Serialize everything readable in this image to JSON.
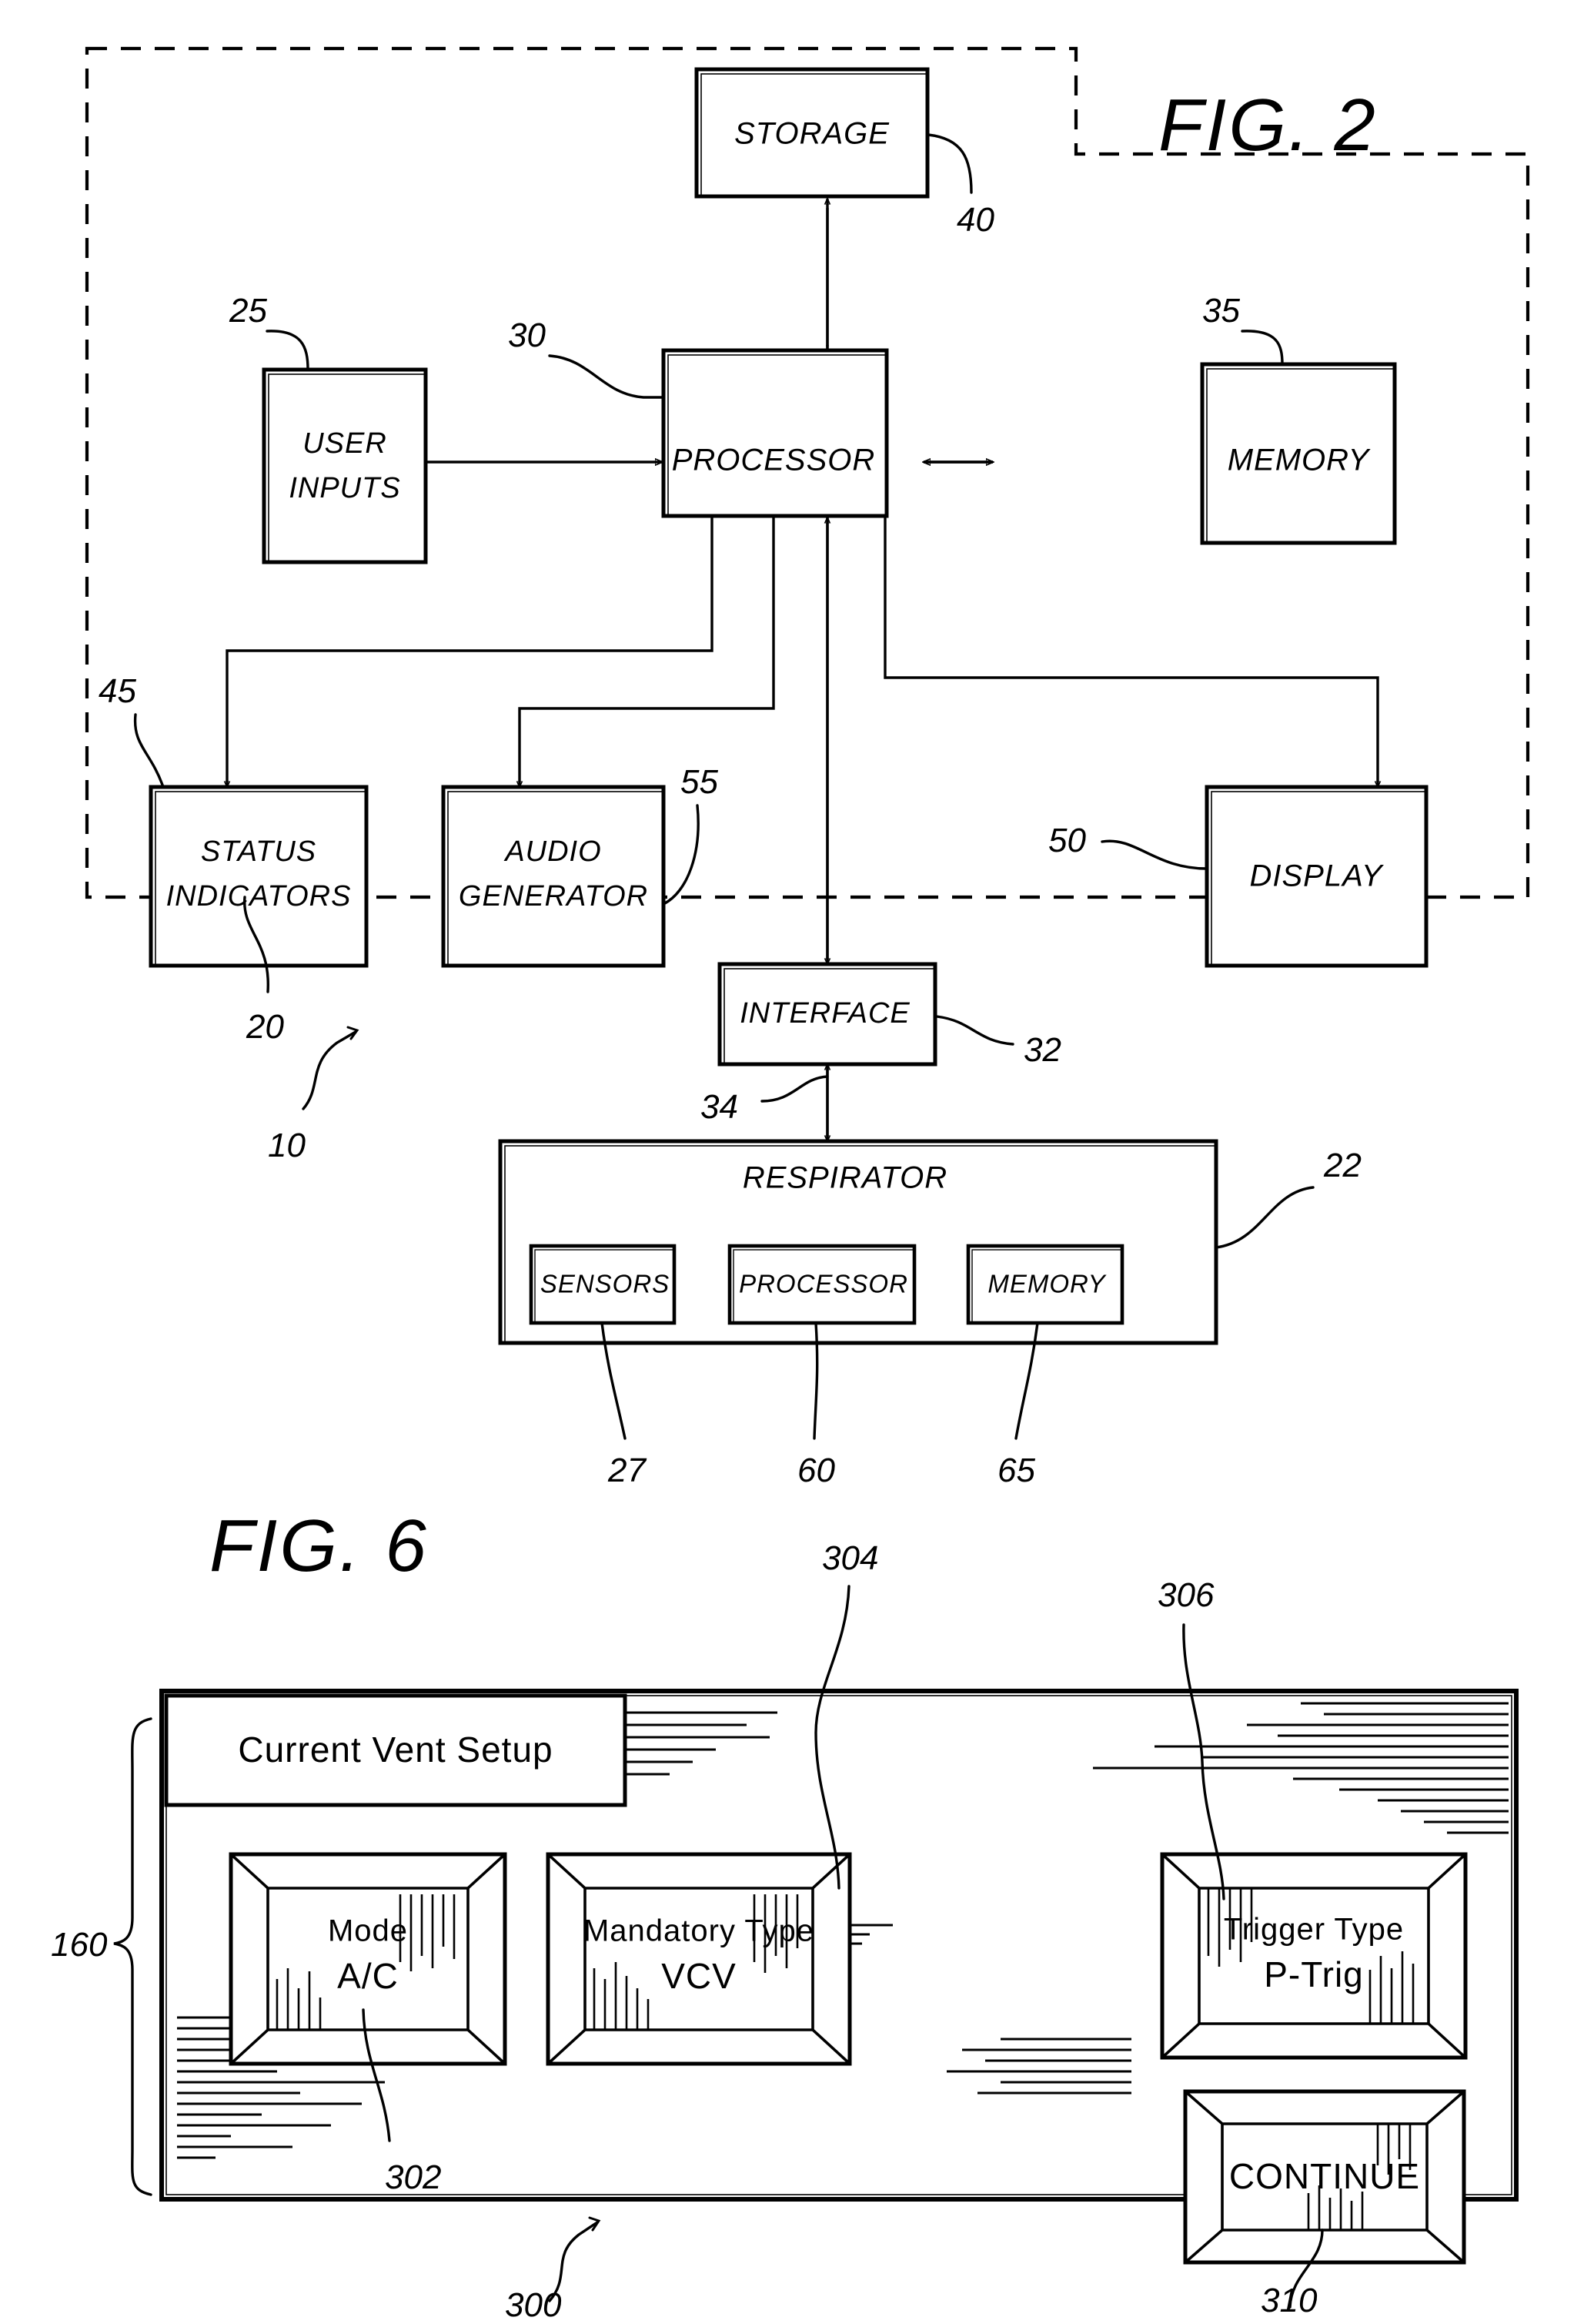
{
  "figures": [
    {
      "id": "fig2",
      "title": "FIG.  2",
      "blocks": {
        "storage": "STORAGE",
        "user_inputs_line1": "USER",
        "user_inputs_line2": "INPUTS",
        "processor": "PROCESSOR",
        "memory": "MEMORY",
        "status_line1": "STATUS",
        "status_line2": "INDICATORS",
        "audio_line1": "AUDIO",
        "audio_line2": "GENERATOR",
        "display": "DISPLAY",
        "interface": "INTERFACE",
        "respirator": "RESPIRATOR",
        "resp_sensors": "SENSORS",
        "resp_processor": "PROCESSOR",
        "resp_memory": "MEMORY"
      },
      "reference_numerals": {
        "system": "10",
        "monitor_unit": "20",
        "respirator_unit": "22",
        "user_inputs": "25",
        "sensors": "27",
        "processor": "30",
        "interface": "32",
        "link": "34",
        "memory": "35",
        "storage": "40",
        "status_indicators": "45",
        "display": "50",
        "audio_generator": "55",
        "resp_processor": "60",
        "resp_memory": "65"
      }
    },
    {
      "id": "fig6",
      "title": "FIG.  6",
      "screen_title": "Current Vent Setup",
      "buttons": [
        {
          "key": "mode",
          "label": "Mode",
          "value": "A/C"
        },
        {
          "key": "mandatory_type",
          "label": "Mandatory Type",
          "value": "VCV"
        },
        {
          "key": "trigger_type",
          "label": "Trigger Type",
          "value": "P-Trig"
        },
        {
          "key": "continue",
          "label": "CONTINUE",
          "value": ""
        }
      ],
      "reference_numerals": {
        "display_screen": "160",
        "screen_300": "300",
        "mode_button": "302",
        "mandatory_button": "304",
        "trigger_button": "306",
        "continue_button": "310"
      }
    }
  ],
  "colors": {
    "ink": "#000000",
    "paper": "#ffffff"
  }
}
